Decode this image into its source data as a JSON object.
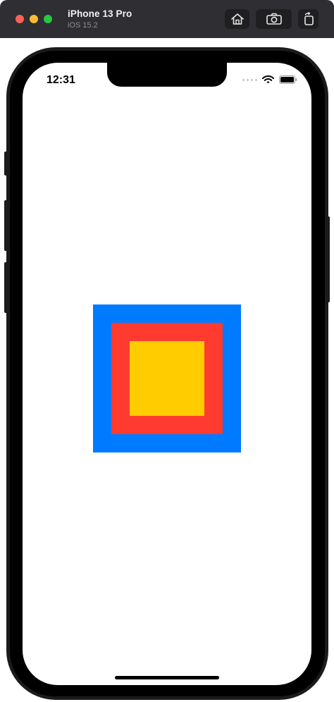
{
  "window": {
    "device_name": "iPhone 13 Pro",
    "os_version": "iOS 15.2",
    "toolbar": {
      "home_icon": "home-icon",
      "screenshot_icon": "camera-icon",
      "rotate_icon": "rotate-icon"
    }
  },
  "status_bar": {
    "time": "12:31",
    "icons": [
      "cellular-dots-icon",
      "wifi-icon",
      "battery-icon"
    ]
  },
  "content": {
    "squares": [
      {
        "name": "outer",
        "color": "#007aff"
      },
      {
        "name": "middle",
        "color": "#ff3b30"
      },
      {
        "name": "inner",
        "color": "#ffcc00"
      }
    ]
  }
}
